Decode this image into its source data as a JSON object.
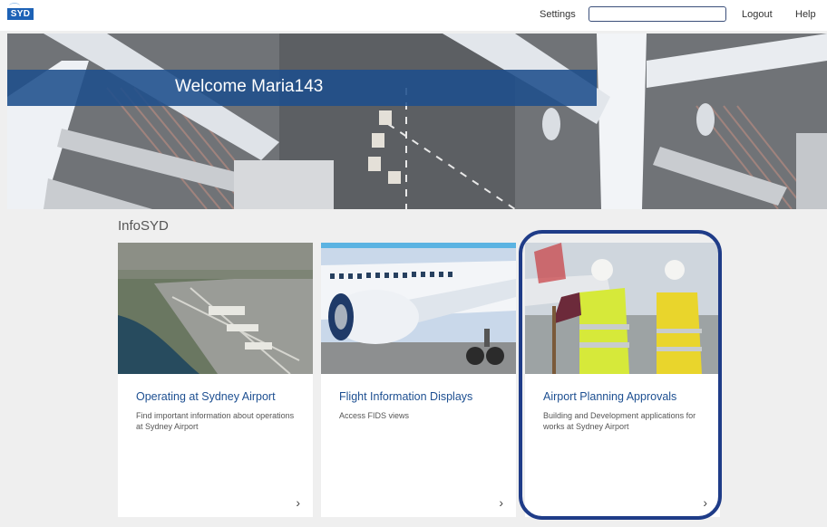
{
  "header": {
    "logo_text": "SYD",
    "settings_label": "Settings",
    "search": {
      "value": "",
      "placeholder": ""
    },
    "logout_label": "Logout",
    "help_label": "Help"
  },
  "hero": {
    "welcome_text": "Welcome Maria143"
  },
  "section": {
    "title": "InfoSYD"
  },
  "cards": [
    {
      "title": "Operating at Sydney Airport",
      "description": "Find important information about operations at Sydney Airport",
      "chevron": "›"
    },
    {
      "title": "Flight Information Displays",
      "description": "Access FIDS views",
      "chevron": "›"
    },
    {
      "title": "Airport Planning Approvals",
      "description": "Building and Development applications for works at Sydney Airport",
      "chevron": "›"
    }
  ],
  "colors": {
    "brand_blue": "#1d62b6",
    "band_blue": "#1e4e8c",
    "card_title": "#1d4f91",
    "highlight": "#1f3c88"
  }
}
